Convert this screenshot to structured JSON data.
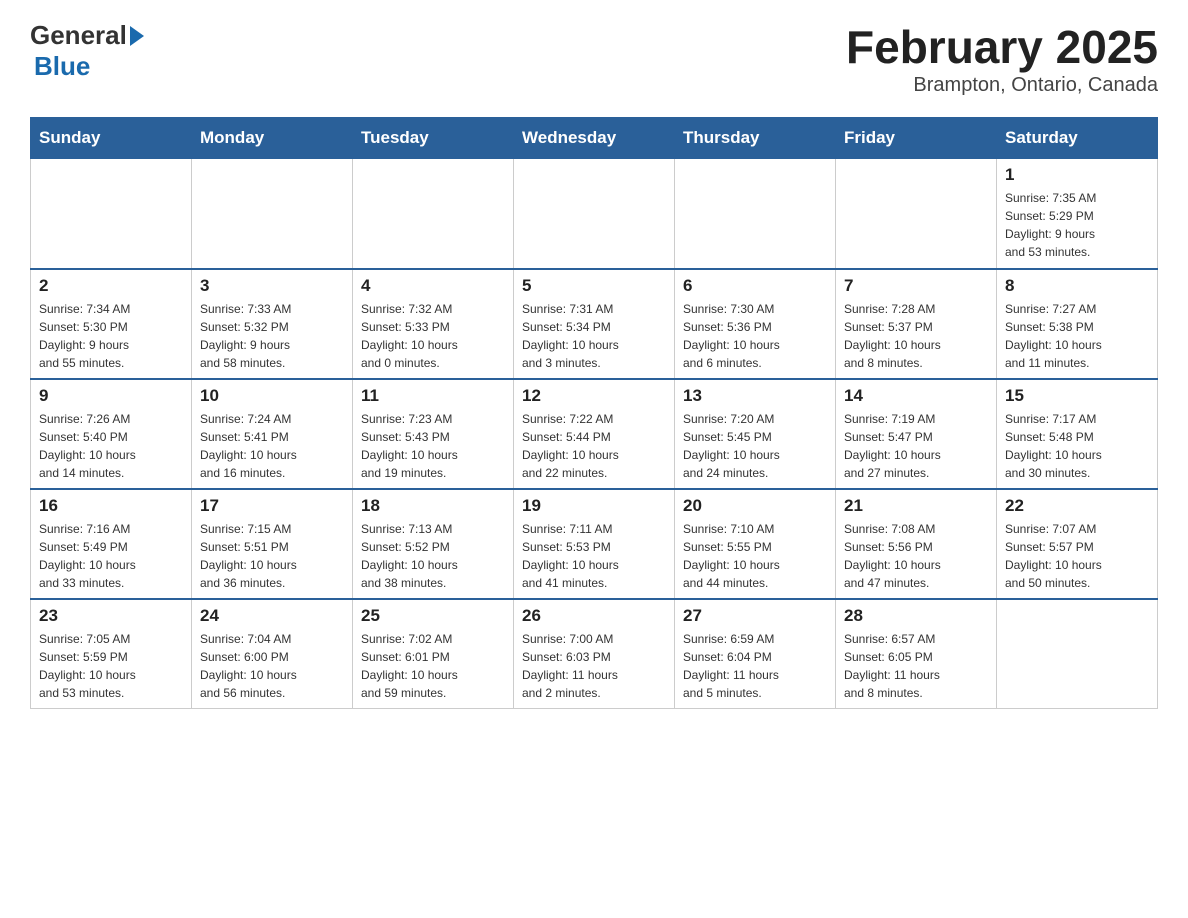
{
  "logo": {
    "general": "General",
    "blue": "Blue"
  },
  "title": "February 2025",
  "subtitle": "Brampton, Ontario, Canada",
  "weekdays": [
    "Sunday",
    "Monday",
    "Tuesday",
    "Wednesday",
    "Thursday",
    "Friday",
    "Saturday"
  ],
  "weeks": [
    [
      {
        "day": "",
        "info": ""
      },
      {
        "day": "",
        "info": ""
      },
      {
        "day": "",
        "info": ""
      },
      {
        "day": "",
        "info": ""
      },
      {
        "day": "",
        "info": ""
      },
      {
        "day": "",
        "info": ""
      },
      {
        "day": "1",
        "info": "Sunrise: 7:35 AM\nSunset: 5:29 PM\nDaylight: 9 hours\nand 53 minutes."
      }
    ],
    [
      {
        "day": "2",
        "info": "Sunrise: 7:34 AM\nSunset: 5:30 PM\nDaylight: 9 hours\nand 55 minutes."
      },
      {
        "day": "3",
        "info": "Sunrise: 7:33 AM\nSunset: 5:32 PM\nDaylight: 9 hours\nand 58 minutes."
      },
      {
        "day": "4",
        "info": "Sunrise: 7:32 AM\nSunset: 5:33 PM\nDaylight: 10 hours\nand 0 minutes."
      },
      {
        "day": "5",
        "info": "Sunrise: 7:31 AM\nSunset: 5:34 PM\nDaylight: 10 hours\nand 3 minutes."
      },
      {
        "day": "6",
        "info": "Sunrise: 7:30 AM\nSunset: 5:36 PM\nDaylight: 10 hours\nand 6 minutes."
      },
      {
        "day": "7",
        "info": "Sunrise: 7:28 AM\nSunset: 5:37 PM\nDaylight: 10 hours\nand 8 minutes."
      },
      {
        "day": "8",
        "info": "Sunrise: 7:27 AM\nSunset: 5:38 PM\nDaylight: 10 hours\nand 11 minutes."
      }
    ],
    [
      {
        "day": "9",
        "info": "Sunrise: 7:26 AM\nSunset: 5:40 PM\nDaylight: 10 hours\nand 14 minutes."
      },
      {
        "day": "10",
        "info": "Sunrise: 7:24 AM\nSunset: 5:41 PM\nDaylight: 10 hours\nand 16 minutes."
      },
      {
        "day": "11",
        "info": "Sunrise: 7:23 AM\nSunset: 5:43 PM\nDaylight: 10 hours\nand 19 minutes."
      },
      {
        "day": "12",
        "info": "Sunrise: 7:22 AM\nSunset: 5:44 PM\nDaylight: 10 hours\nand 22 minutes."
      },
      {
        "day": "13",
        "info": "Sunrise: 7:20 AM\nSunset: 5:45 PM\nDaylight: 10 hours\nand 24 minutes."
      },
      {
        "day": "14",
        "info": "Sunrise: 7:19 AM\nSunset: 5:47 PM\nDaylight: 10 hours\nand 27 minutes."
      },
      {
        "day": "15",
        "info": "Sunrise: 7:17 AM\nSunset: 5:48 PM\nDaylight: 10 hours\nand 30 minutes."
      }
    ],
    [
      {
        "day": "16",
        "info": "Sunrise: 7:16 AM\nSunset: 5:49 PM\nDaylight: 10 hours\nand 33 minutes."
      },
      {
        "day": "17",
        "info": "Sunrise: 7:15 AM\nSunset: 5:51 PM\nDaylight: 10 hours\nand 36 minutes."
      },
      {
        "day": "18",
        "info": "Sunrise: 7:13 AM\nSunset: 5:52 PM\nDaylight: 10 hours\nand 38 minutes."
      },
      {
        "day": "19",
        "info": "Sunrise: 7:11 AM\nSunset: 5:53 PM\nDaylight: 10 hours\nand 41 minutes."
      },
      {
        "day": "20",
        "info": "Sunrise: 7:10 AM\nSunset: 5:55 PM\nDaylight: 10 hours\nand 44 minutes."
      },
      {
        "day": "21",
        "info": "Sunrise: 7:08 AM\nSunset: 5:56 PM\nDaylight: 10 hours\nand 47 minutes."
      },
      {
        "day": "22",
        "info": "Sunrise: 7:07 AM\nSunset: 5:57 PM\nDaylight: 10 hours\nand 50 minutes."
      }
    ],
    [
      {
        "day": "23",
        "info": "Sunrise: 7:05 AM\nSunset: 5:59 PM\nDaylight: 10 hours\nand 53 minutes."
      },
      {
        "day": "24",
        "info": "Sunrise: 7:04 AM\nSunset: 6:00 PM\nDaylight: 10 hours\nand 56 minutes."
      },
      {
        "day": "25",
        "info": "Sunrise: 7:02 AM\nSunset: 6:01 PM\nDaylight: 10 hours\nand 59 minutes."
      },
      {
        "day": "26",
        "info": "Sunrise: 7:00 AM\nSunset: 6:03 PM\nDaylight: 11 hours\nand 2 minutes."
      },
      {
        "day": "27",
        "info": "Sunrise: 6:59 AM\nSunset: 6:04 PM\nDaylight: 11 hours\nand 5 minutes."
      },
      {
        "day": "28",
        "info": "Sunrise: 6:57 AM\nSunset: 6:05 PM\nDaylight: 11 hours\nand 8 minutes."
      },
      {
        "day": "",
        "info": ""
      }
    ]
  ]
}
